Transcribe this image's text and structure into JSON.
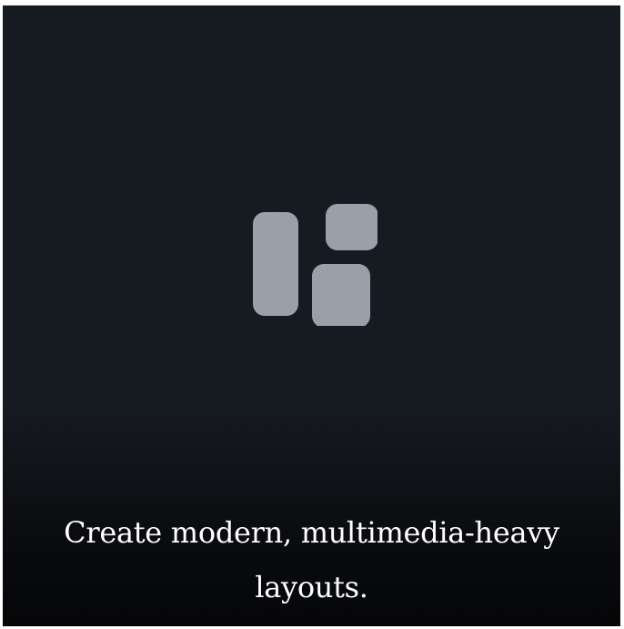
{
  "card": {
    "icon": "layout-icon",
    "caption": "Create modern, multimedia-heavy layouts."
  },
  "colors": {
    "background": "#161a21",
    "icon": "#9b9fa9",
    "caption_text": "#ffffff"
  }
}
